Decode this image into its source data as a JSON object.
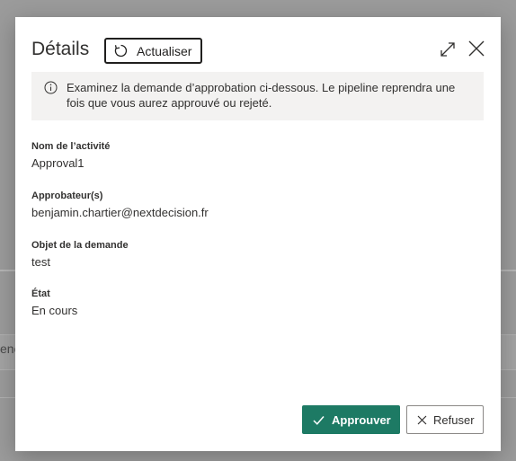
{
  "background": {
    "row_text": "enc"
  },
  "dialog": {
    "title": "Détails",
    "refresh_label": "Actualiser",
    "info_message": "Examinez la demande d’approbation ci-dessous. Le pipeline reprendra une fois que vous aurez approuvé ou rejeté.",
    "fields": [
      {
        "label": "Nom de l’activité",
        "value": "Approval1"
      },
      {
        "label": "Approbateur(s)",
        "value": "benjamin.chartier@nextdecision.fr"
      },
      {
        "label": "Objet de la demande",
        "value": "test"
      },
      {
        "label": "État",
        "value": "En cours"
      }
    ],
    "approve_label": "Approuver",
    "reject_label": "Refuser"
  },
  "colors": {
    "approve_bg": "#1d7a64",
    "overlay": "#9b9b9b"
  },
  "icons": {
    "refresh": "refresh-icon",
    "expand": "expand-icon",
    "close": "close-icon",
    "info": "info-icon",
    "check": "checkmark-icon",
    "reject": "close-icon"
  }
}
